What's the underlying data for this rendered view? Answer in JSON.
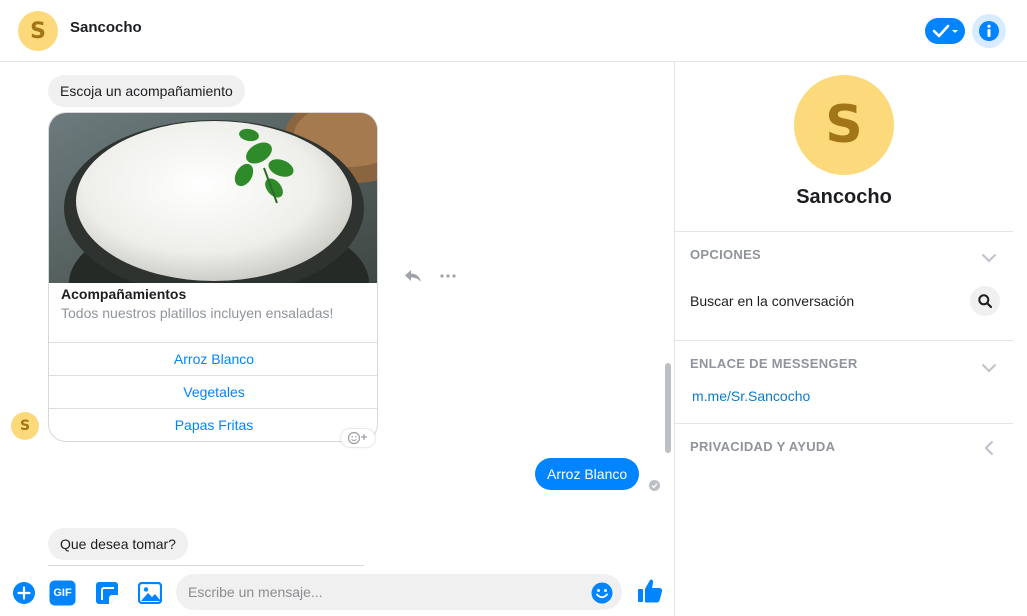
{
  "header": {
    "avatar_letter": "S",
    "title": "Sancocho"
  },
  "chat": {
    "messages": {
      "prompt_side": "Escoja un acompañamiento",
      "card": {
        "title": "Acompañamientos",
        "subtitle": "Todos nuestros platillos incluyen ensaladas!",
        "buttons": [
          "Arroz Blanco",
          "Vegetales",
          "Papas Fritas"
        ]
      },
      "user_reply": "Arroz Blanco",
      "prompt_drink": "Que desea tomar?"
    },
    "sender_avatar_letter": "S"
  },
  "composer": {
    "placeholder": "Escribe un mensaje...",
    "gif_label": "GIF"
  },
  "panel": {
    "avatar_letter": "S",
    "name": "Sancocho",
    "sections": {
      "options": {
        "heading": "OPCIONES",
        "search_label": "Buscar en la conversación"
      },
      "messenger_link": {
        "heading": "ENLACE DE MESSENGER",
        "url": "m.me/Sr.Sancocho"
      },
      "privacy": {
        "heading": "PRIVACIDAD Y AYUDA"
      }
    }
  },
  "colors": {
    "accent": "#0084ff",
    "avatar_bg": "#fcd97a",
    "avatar_fg": "#a27519",
    "bubble_in": "#f1f0f0",
    "link": "#0a7cce"
  }
}
